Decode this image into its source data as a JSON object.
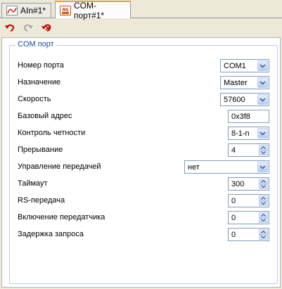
{
  "tabs": [
    {
      "label": "AIn#1*",
      "icon": "analog-input-icon",
      "active": false
    },
    {
      "label": "COM-порт#1*",
      "icon": "rs232-icon",
      "active": true
    }
  ],
  "toolbar": {
    "buttons": [
      {
        "name": "undo-button",
        "icon": "undo-icon",
        "enabled": true
      },
      {
        "name": "redo-button",
        "icon": "redo-icon",
        "enabled": false
      },
      {
        "name": "revert-button",
        "icon": "revert-icon",
        "enabled": true
      }
    ]
  },
  "group": {
    "title": "COM порт",
    "fields": [
      {
        "label": "Номер порта",
        "value": "COM1",
        "control": "dropdown"
      },
      {
        "label": "Назначение",
        "value": "Master",
        "control": "dropdown"
      },
      {
        "label": "Скорость",
        "value": "57600",
        "control": "dropdown"
      },
      {
        "label": "Базовый адрес",
        "value": "0x3f8",
        "control": "text"
      },
      {
        "label": "Контроль четности",
        "value": "8-1-n",
        "control": "dropdown"
      },
      {
        "label": "Прерывание",
        "value": "4",
        "control": "spinner"
      },
      {
        "label": "Управление передачей",
        "value": "нет",
        "control": "dropdown"
      },
      {
        "label": "Таймаут",
        "value": "300",
        "control": "spinner"
      },
      {
        "label": "RS-передача",
        "value": "0",
        "control": "spinner"
      },
      {
        "label": "Включение передатчика",
        "value": "0",
        "control": "spinner"
      },
      {
        "label": "Задержка запроса",
        "value": "0",
        "control": "spinner"
      }
    ]
  },
  "colors": {
    "accent": "#e6a237",
    "group_title": "#1c4ba3",
    "border": "#7f9db9"
  }
}
